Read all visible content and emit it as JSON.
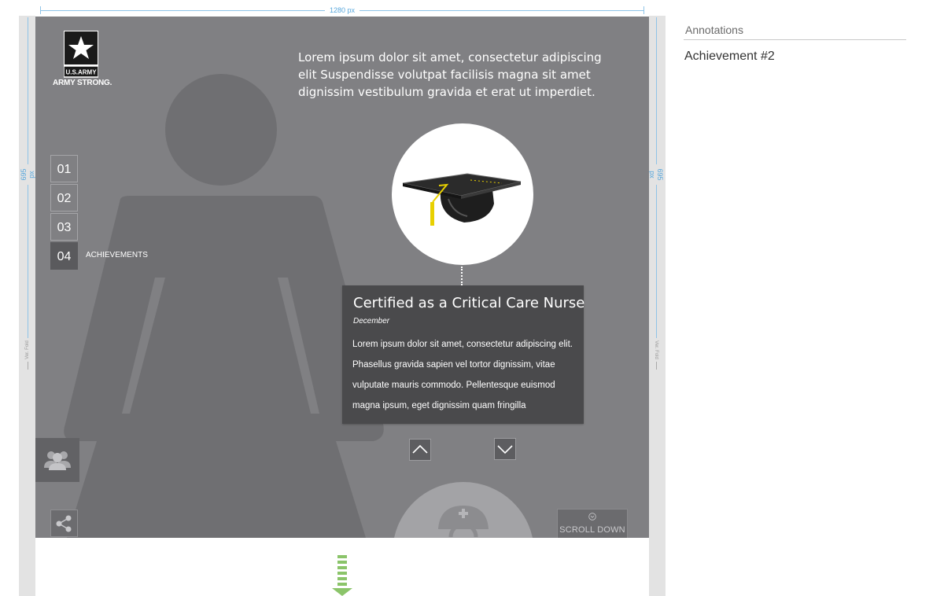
{
  "canvas": {
    "width_label": "1280 px",
    "height_label": "695 px",
    "fold_label": "Ver. Fold"
  },
  "brand": {
    "wordmark": "U.S.ARMY",
    "tagline": "ARMY STRONG."
  },
  "intro": {
    "text": "Lorem ipsum dolor sit amet, consectetur adipiscing elit Suspendisse volutpat facilisis magna sit amet dignissim vestibulum gravida et erat ut imperdiet."
  },
  "steps": {
    "items": [
      {
        "label": "01"
      },
      {
        "label": "02"
      },
      {
        "label": "03"
      },
      {
        "label": "04"
      }
    ],
    "active_label": "ACHIEVEMENTS"
  },
  "achievement": {
    "icon": "graduation-cap-icon",
    "title": "Certified as a Critical Care Nurse",
    "date": "December",
    "body": "Lorem ipsum dolor sit amet, consectetur adipiscing elit. Phasellus gravida sapien vel tortor dignissim, vitae vulputate mauris commodo. Pellentesque euismod magna ipsum, eget dignissim quam fringilla"
  },
  "controls": {
    "scroll_down": "SCROLL DOWN"
  },
  "annotations": {
    "title": "Annotations",
    "items": [
      "Achievement #2"
    ]
  },
  "colors": {
    "stage": "#808083",
    "silhouette": "#6f6f72",
    "card": "#4a4a4c",
    "accent_yellow": "#e8d000",
    "accent_green": "#8bc46a",
    "dimension_blue": "#5aa8dc"
  }
}
